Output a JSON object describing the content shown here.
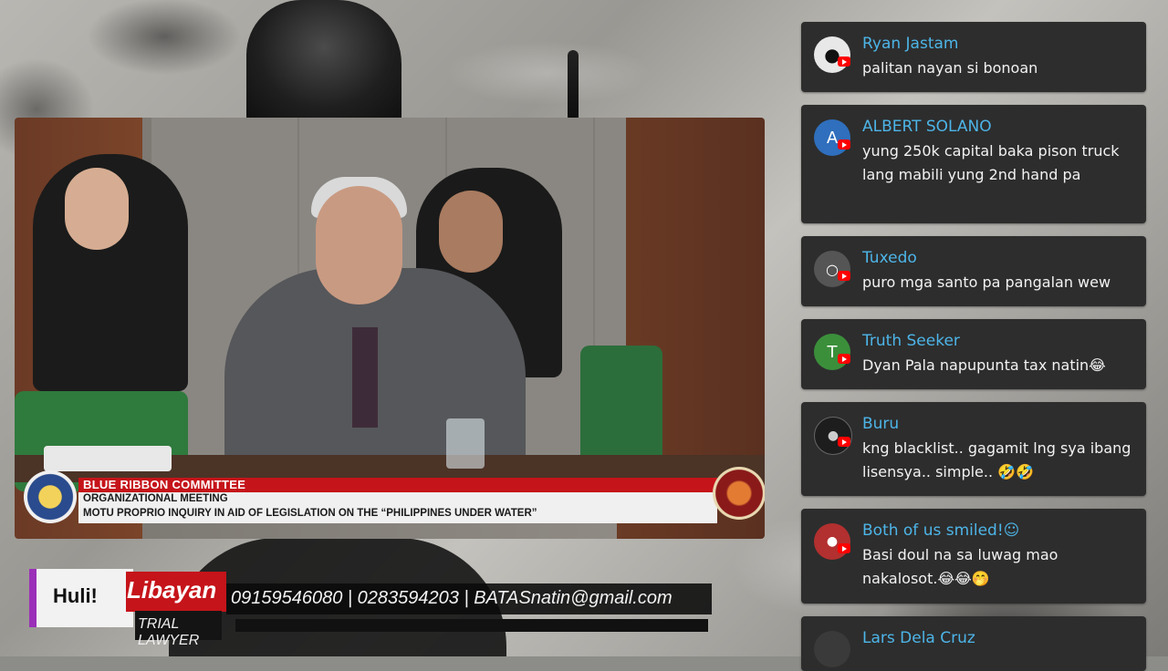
{
  "video": {
    "lower_third": {
      "title": "BLUE RIBBON COMMITTEE",
      "line1": "ORGANIZATIONAL MEETING",
      "line2": "MOTU PROPRIO INQUIRY IN AID OF LEGISLATION ON THE “PHILIPPINES UNDER WATER”"
    }
  },
  "brand": {
    "tag": "Huli!",
    "name": "Libayan",
    "role": "TRIAL LAWYER",
    "contact": "09159546080 | 0283594203 | BATASnatin@gmail.com"
  },
  "chat": {
    "messages": [
      {
        "author": "Ryan Jastam",
        "text": "palitan nayan si bonoan",
        "avatar_letter": "",
        "avatar_color": "#e8e8e8"
      },
      {
        "author": "ALBERT SOLANO",
        "text": "yung 250k capital baka pison truck lang mabili yung 2nd hand pa",
        "avatar_letter": "A",
        "avatar_color": "#2f6fbd"
      },
      {
        "author": "Tuxedo",
        "text": "puro mga santo pa pangalan wew",
        "avatar_letter": "",
        "avatar_color": "#555555"
      },
      {
        "author": "Truth Seeker",
        "text": "Dyan Pala napupunta tax natin😂",
        "avatar_letter": "T",
        "avatar_color": "#3b8f3b"
      },
      {
        "author": "Buru",
        "text": "kng blacklist.. gagamit lng sya ibang lisensya.. simple.. 🤣🤣",
        "avatar_letter": "",
        "avatar_color": "#1d1d1d"
      },
      {
        "author": "Both of us smiled!☺",
        "text": "Basi doul na sa luwag mao nakalosot.😂😂🤭",
        "avatar_letter": "",
        "avatar_color": "#b2302f"
      },
      {
        "author": "Lars Dela Cruz",
        "text": "",
        "avatar_letter": "",
        "avatar_color": "#3a3a3a"
      }
    ]
  }
}
